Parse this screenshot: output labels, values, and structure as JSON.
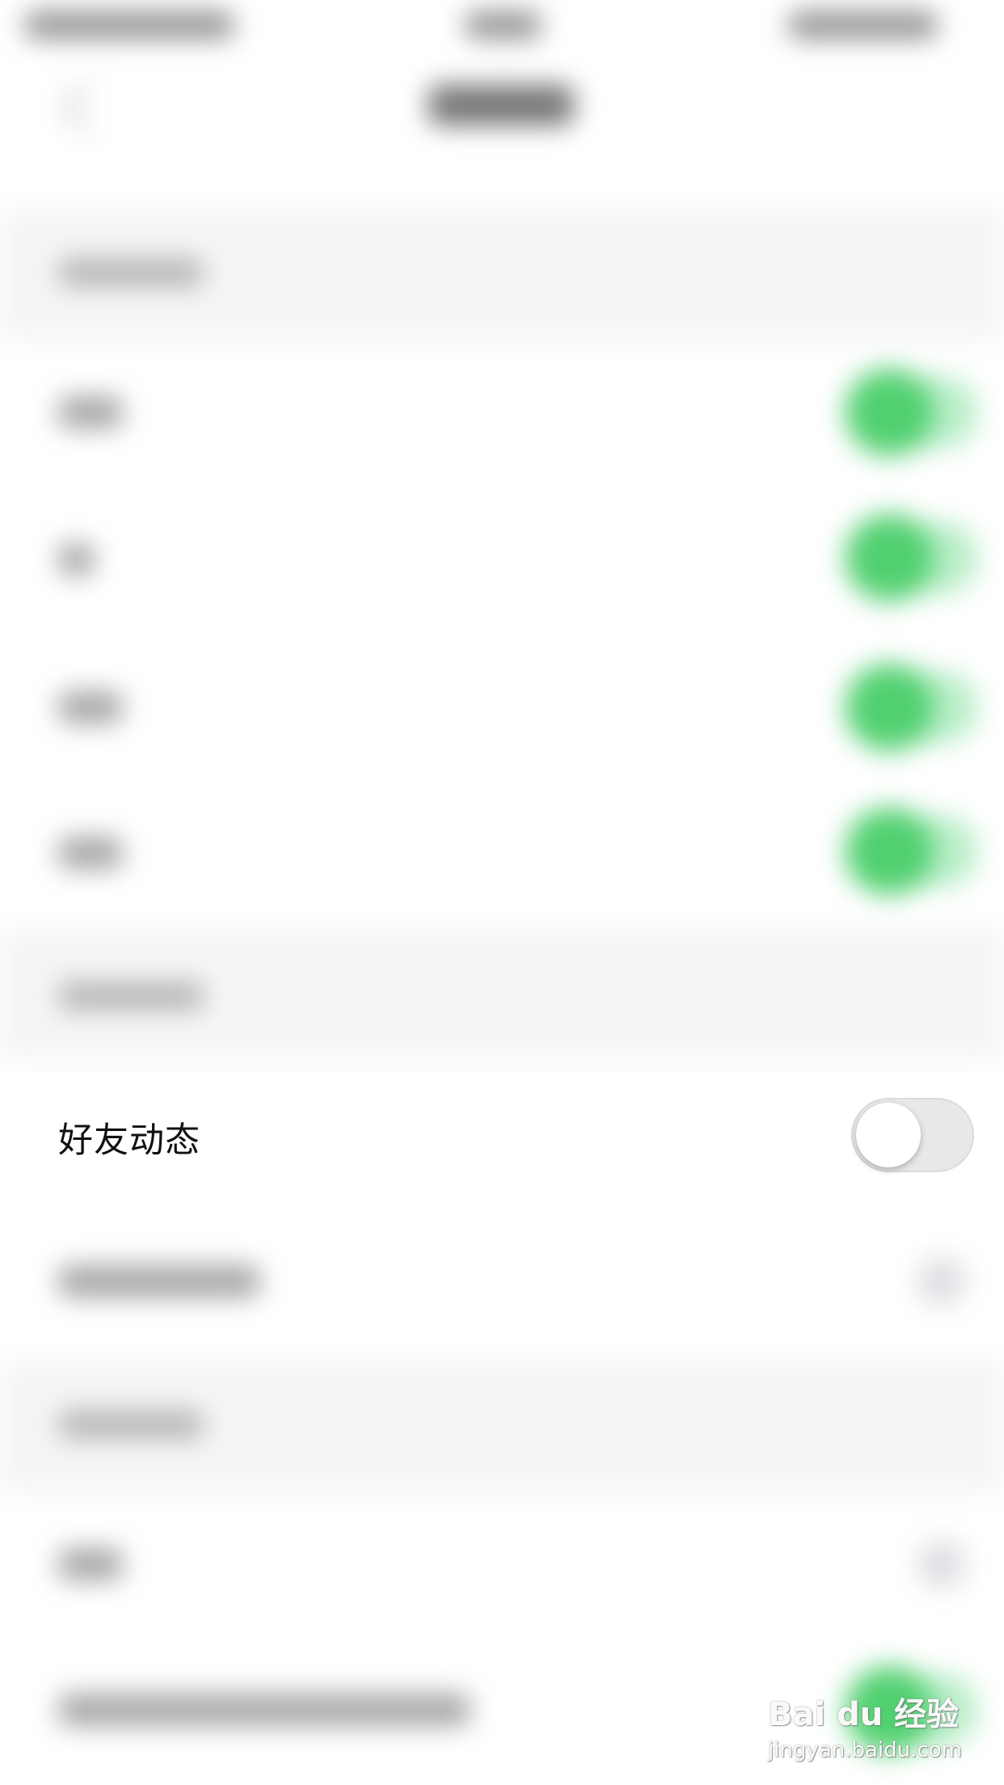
{
  "settings": {
    "visible_row": {
      "label": "好友动态",
      "toggle_on": false
    }
  },
  "watermark": {
    "logo_text": "Bai du 经验",
    "url_text": "jingyan.baidu.com"
  },
  "colors": {
    "toggle_on": "#2fc653",
    "toggle_off_track": "#e8e8ea",
    "section_bg": "#f4f5f7"
  },
  "icons": [
    "back-icon",
    "paw-icon"
  ]
}
